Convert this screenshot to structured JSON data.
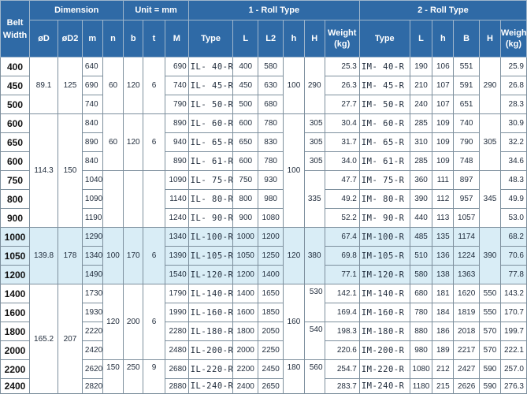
{
  "header": {
    "belt_width": "Belt Width",
    "dimension": "Dimension",
    "unit": "Unit = mm",
    "roll1": "1 - Roll Type",
    "roll2": "2 - Roll Type",
    "cols_dim": [
      "øD",
      "øD2",
      "m",
      "n",
      "b",
      "t",
      "M"
    ],
    "cols_r1": [
      "Type",
      "L",
      "L2",
      "h",
      "H",
      "Weight (kg)"
    ],
    "cols_r2": [
      "Type",
      "L",
      "h",
      "B",
      "H",
      "Weight (kg)"
    ]
  },
  "rows": [
    {
      "bw": "400",
      "m": "640",
      "M": "690",
      "t1": "IL- 40-R",
      "L": "400",
      "L2": "580",
      "w1": "25.3",
      "t2": "IM- 40-R",
      "L_2": "190",
      "h_2": "106",
      "B": "551",
      "w2": "25.9"
    },
    {
      "bw": "450",
      "m": "690",
      "M": "740",
      "t1": "IL- 45-R",
      "L": "450",
      "L2": "630",
      "w1": "26.3",
      "t2": "IM- 45-R",
      "L_2": "210",
      "h_2": "107",
      "B": "591",
      "w2": "26.8"
    },
    {
      "bw": "500",
      "m": "740",
      "M": "790",
      "t1": "IL- 50-R",
      "L": "500",
      "L2": "680",
      "w1": "27.7",
      "t2": "IM- 50-R",
      "L_2": "240",
      "h_2": "107",
      "B": "651",
      "w2": "28.3"
    },
    {
      "bw": "600",
      "m": "840",
      "M": "890",
      "t1": "IL- 60-R",
      "L": "600",
      "L2": "780",
      "w1": "30.4",
      "t2": "IM- 60-R",
      "L_2": "285",
      "h_2": "109",
      "B": "740",
      "w2": "30.9"
    },
    {
      "bw": "650",
      "m": "890",
      "M": "940",
      "t1": "IL- 65-R",
      "L": "650",
      "L2": "830",
      "w1": "31.7",
      "t2": "IM- 65-R",
      "L_2": "310",
      "h_2": "109",
      "B": "790",
      "w2": "32.2"
    },
    {
      "bw": "600",
      "m": "840",
      "M": "890",
      "t1": "IL- 61-R",
      "L": "600",
      "L2": "780",
      "w1": "34.0",
      "t2": "IM- 61-R",
      "L_2": "285",
      "h_2": "109",
      "B": "748",
      "w2": "34.6"
    },
    {
      "bw": "750",
      "m": "1040",
      "M": "1090",
      "t1": "IL- 75-R",
      "L": "750",
      "L2": "930",
      "w1": "47.7",
      "t2": "IM- 75-R",
      "L_2": "360",
      "h_2": "111",
      "B": "897",
      "w2": "48.3"
    },
    {
      "bw": "800",
      "m": "1090",
      "M": "1140",
      "t1": "IL- 80-R",
      "L": "800",
      "L2": "980",
      "w1": "49.2",
      "t2": "IM- 80-R",
      "L_2": "390",
      "h_2": "112",
      "B": "957",
      "w2": "49.9"
    },
    {
      "bw": "900",
      "m": "1190",
      "M": "1240",
      "t1": "IL- 90-R",
      "L": "900",
      "L2": "1080",
      "w1": "52.2",
      "t2": "IM- 90-R",
      "L_2": "440",
      "h_2": "113",
      "B": "1057",
      "w2": "53.0"
    },
    {
      "bw": "1000",
      "m": "1290",
      "M": "1340",
      "t1": "IL-100-R",
      "L": "1000",
      "L2": "1200",
      "w1": "67.4",
      "t2": "IM-100-R",
      "L_2": "485",
      "h_2": "135",
      "B": "1174",
      "w2": "68.2"
    },
    {
      "bw": "1050",
      "m": "1340",
      "M": "1390",
      "t1": "IL-105-R",
      "L": "1050",
      "L2": "1250",
      "w1": "69.8",
      "t2": "IM-105-R",
      "L_2": "510",
      "h_2": "136",
      "B": "1224",
      "w2": "70.6"
    },
    {
      "bw": "1200",
      "m": "1490",
      "M": "1540",
      "t1": "IL-120-R",
      "L": "1200",
      "L2": "1400",
      "w1": "77.1",
      "t2": "IM-120-R",
      "L_2": "580",
      "h_2": "138",
      "B": "1363",
      "w2": "77.8"
    },
    {
      "bw": "1400",
      "m": "1730",
      "M": "1790",
      "t1": "IL-140-R",
      "L": "1400",
      "L2": "1650",
      "w1": "142.1",
      "t2": "IM-140-R",
      "L_2": "680",
      "h_2": "181",
      "B": "1620",
      "H_2": "550",
      "w2": "143.2"
    },
    {
      "bw": "1600",
      "m": "1930",
      "M": "1990",
      "t1": "IL-160-R",
      "L": "1600",
      "L2": "1850",
      "w1": "169.4",
      "t2": "IM-160-R",
      "L_2": "780",
      "h_2": "184",
      "B": "1819",
      "H_2": "550",
      "w2": "170.7"
    },
    {
      "bw": "1800",
      "m": "2220",
      "M": "2280",
      "t1": "IL-180-R",
      "L": "1800",
      "L2": "2050",
      "w1": "198.3",
      "t2": "IM-180-R",
      "L_2": "880",
      "h_2": "186",
      "B": "2018",
      "H_2": "570",
      "w2": "199.7"
    },
    {
      "bw": "2000",
      "m": "2420",
      "M": "2480",
      "t1": "IL-200-R",
      "L": "2000",
      "L2": "2250",
      "w1": "220.6",
      "t2": "IM-200-R",
      "L_2": "980",
      "h_2": "189",
      "B": "2217",
      "H_2": "570",
      "w2": "222.1"
    },
    {
      "bw": "2200",
      "m": "2620",
      "M": "2680",
      "t1": "IL-220-R",
      "L": "2200",
      "L2": "2450",
      "w1": "254.7",
      "t2": "IM-220-R",
      "L_2": "1080",
      "h_2": "212",
      "B": "2427",
      "H_2": "590",
      "w2": "257.0"
    },
    {
      "bw": "2400",
      "m": "2820",
      "M": "2880",
      "t1": "IL-240-R",
      "L": "2400",
      "L2": "2650",
      "w1": "283.7",
      "t2": "IM-240-R",
      "L_2": "1180",
      "h_2": "215",
      "B": "2626",
      "H_2": "590",
      "w2": "276.3"
    }
  ],
  "groups": {
    "g1": {
      "D": "89.1",
      "D2": "125",
      "n": "60",
      "b": "120",
      "t": "6",
      "h": "100",
      "H": "290",
      "H2": "290"
    },
    "g2a": {
      "n": "60",
      "b": "120",
      "t": "6"
    },
    "g2": {
      "D": "114.3",
      "D2": "150",
      "h": "100",
      "H_a": "305",
      "H_b": "305",
      "H_c": "305",
      "H_d": "335",
      "H2": "305",
      "H2b": "345"
    },
    "g3": {
      "D": "139.8",
      "D2": "178",
      "n": "100",
      "b": "170",
      "t": "6",
      "h": "120",
      "H": "380",
      "H2": "390"
    },
    "g4": {
      "D": "165.2",
      "D2": "207",
      "n": "120",
      "b": "200",
      "t": "6",
      "h": "160",
      "H_a": "530",
      "H_b": "540"
    },
    "g5": {
      "n": "150",
      "b": "250",
      "t": "9",
      "h": "180",
      "H": "560"
    }
  }
}
